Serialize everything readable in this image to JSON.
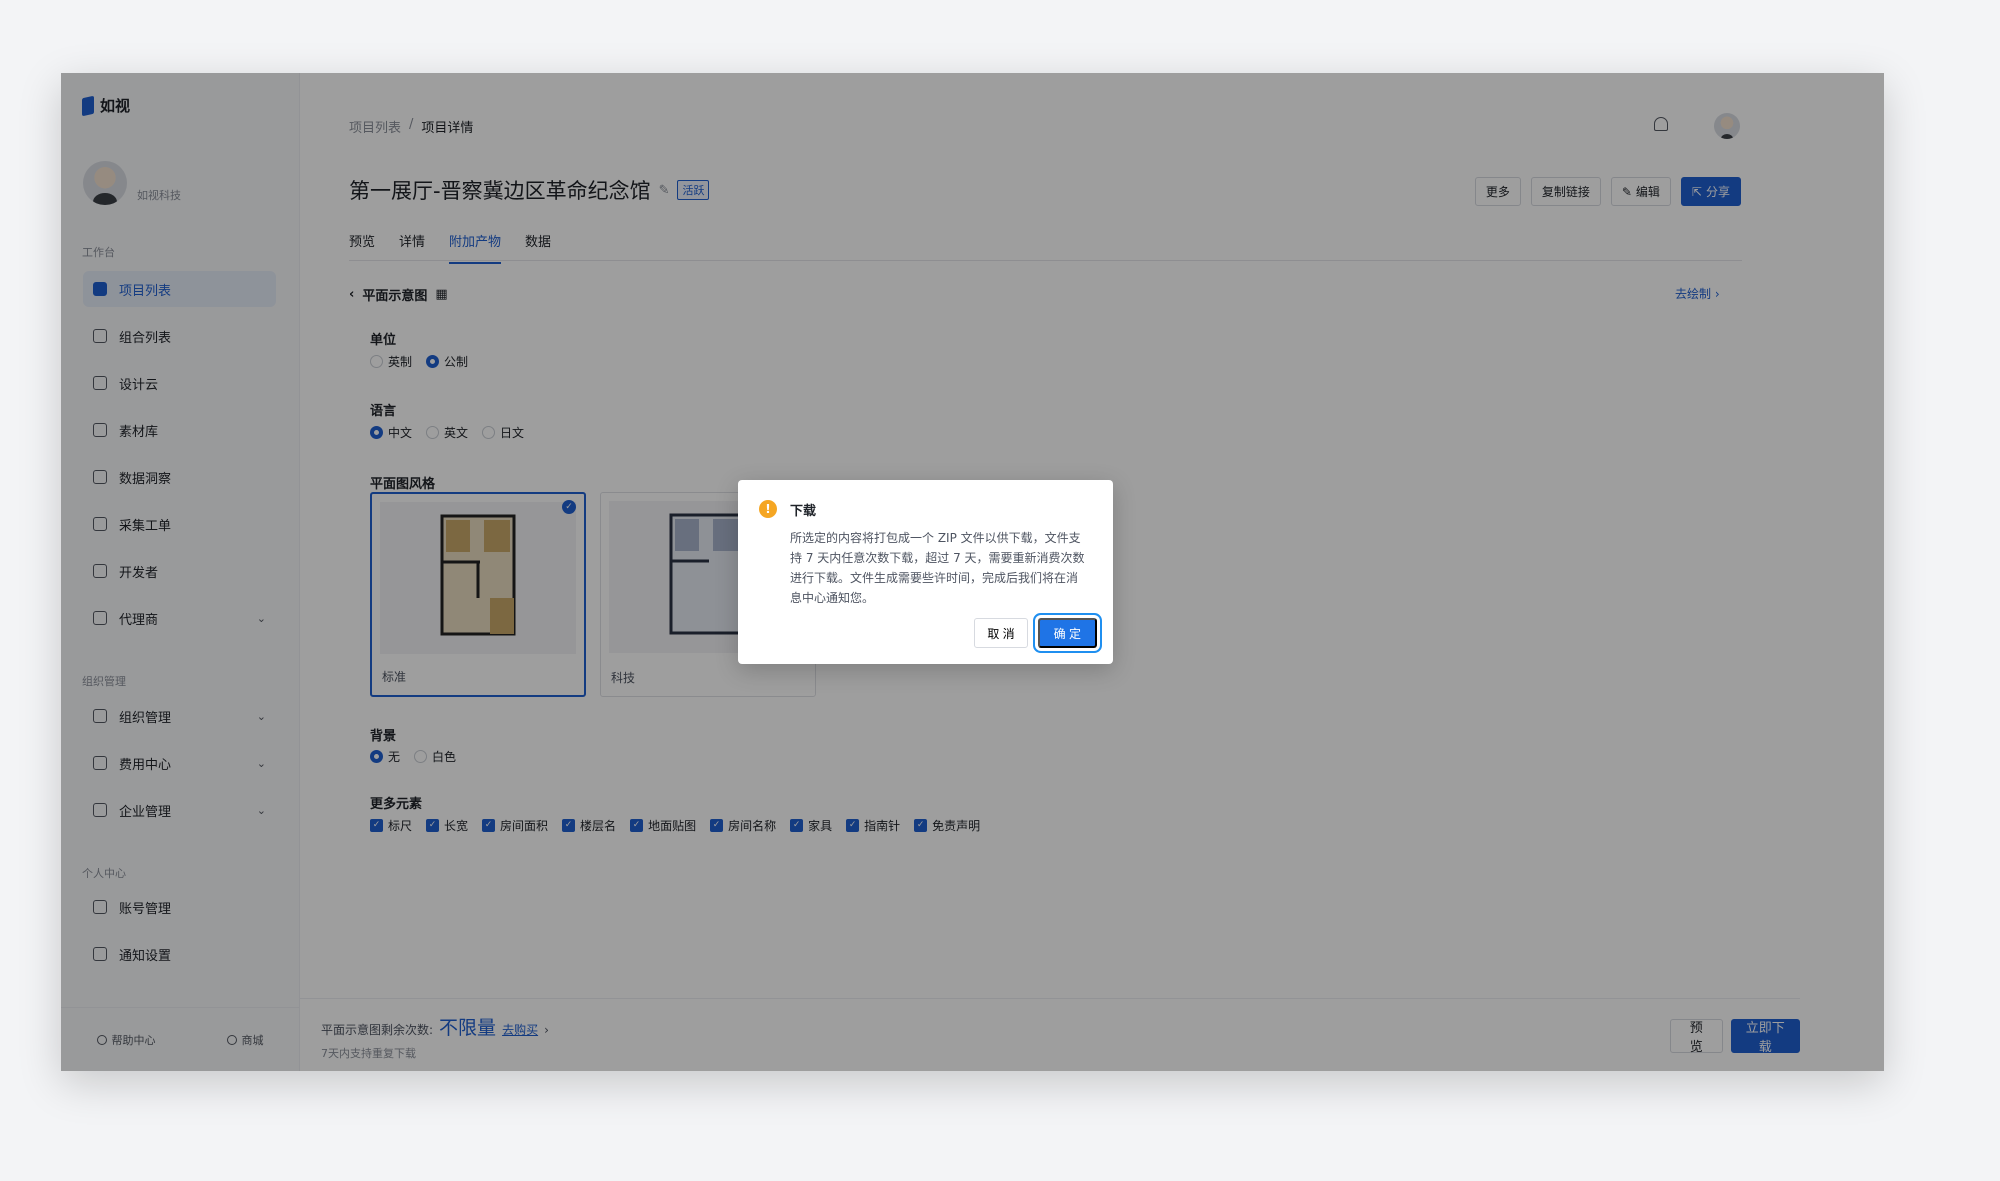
{
  "app": {
    "logo": "如视",
    "user": "如视科技"
  },
  "sidebar": {
    "sections": [
      {
        "title": "工作台",
        "items": [
          {
            "label": "项目列表",
            "active": true
          },
          {
            "label": "组合列表"
          },
          {
            "label": "设计云"
          },
          {
            "label": "素材库"
          },
          {
            "label": "数据洞察"
          },
          {
            "label": "采集工单"
          },
          {
            "label": "开发者"
          },
          {
            "label": "代理商",
            "expandable": true
          }
        ]
      },
      {
        "title": "组织管理",
        "items": [
          {
            "label": "组织管理",
            "expandable": true
          },
          {
            "label": "费用中心",
            "expandable": true
          },
          {
            "label": "企业管理",
            "expandable": true
          }
        ]
      },
      {
        "title": "个人中心",
        "items": [
          {
            "label": "账号管理"
          },
          {
            "label": "通知设置"
          }
        ]
      }
    ],
    "footer": {
      "help": "帮助中心",
      "mall": "商城"
    }
  },
  "header": {
    "breadcrumb": {
      "parent": "项目列表",
      "sep": "/",
      "current": "项目详情"
    },
    "title": "第一展厅-晋察冀边区革命纪念馆",
    "status_tag": "活跃",
    "actions": {
      "more": "更多",
      "copy_link": "复制链接",
      "edit": "编辑",
      "share": "分享"
    },
    "tabs": [
      "预览",
      "详情",
      "附加产物",
      "数据"
    ],
    "active_tab": 2
  },
  "panel": {
    "title": "平面示意图",
    "go_draw": "去绘制",
    "unit": {
      "label": "单位",
      "options": [
        "英制",
        "公制"
      ],
      "selected": 1
    },
    "language": {
      "label": "语言",
      "options": [
        "中文",
        "英文",
        "日文"
      ],
      "selected": 0
    },
    "style": {
      "label": "平面图风格",
      "options": [
        "标准",
        "科技"
      ],
      "selected": 0
    },
    "background": {
      "label": "背景",
      "options": [
        "无",
        "白色"
      ],
      "selected": 0
    },
    "elements": {
      "label": "更多元素",
      "options": [
        "标尺",
        "长宽",
        "房间面积",
        "楼层名",
        "地面贴图",
        "房间名称",
        "家具",
        "指南针",
        "免责声明"
      ]
    }
  },
  "bottom": {
    "remain_label": "平面示意图剩余次数:",
    "remain_value": "不限量",
    "buy": "去购买",
    "note": "7天内支持重复下载",
    "preview": "预 览",
    "download": "立即下载"
  },
  "dialog": {
    "title": "下载",
    "body": "所选定的内容将打包成一个 ZIP 文件以供下载，文件支持 7 天内任意次数下载，超过 7 天，需要重新消费次数进行下载。文件生成需要些许时间，完成后我们将在消息中心通知您。",
    "cancel": "取 消",
    "ok": "确 定"
  },
  "colors": {
    "primary": "#1f5fd1",
    "warning": "#f5a623"
  }
}
